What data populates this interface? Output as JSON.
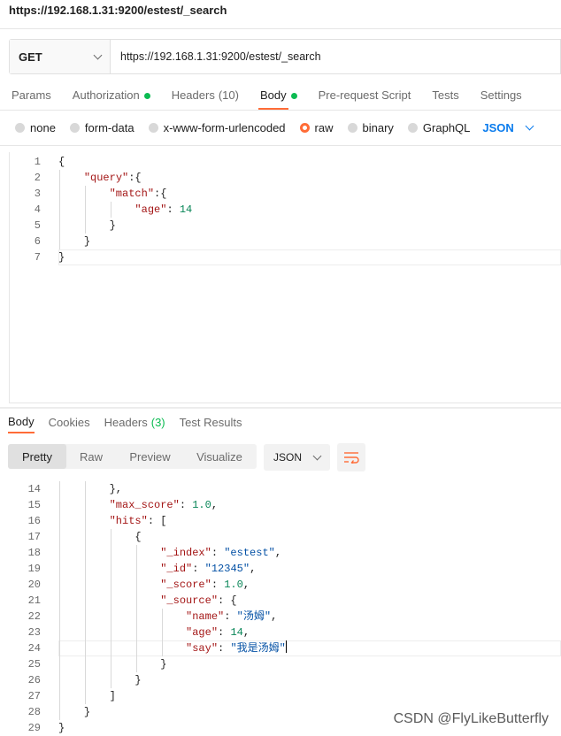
{
  "title": "https://192.168.1.31:9200/estest/_search",
  "request": {
    "method": "GET",
    "url": "https://192.168.1.31:9200/estest/_search"
  },
  "tabs": {
    "params": "Params",
    "authorization": "Authorization",
    "headers": "Headers",
    "headers_count": "(10)",
    "body": "Body",
    "prerequest": "Pre-request Script",
    "tests": "Tests",
    "settings": "Settings"
  },
  "body_options": {
    "none": "none",
    "form_data": "form-data",
    "urlencoded": "x-www-form-urlencoded",
    "raw": "raw",
    "binary": "binary",
    "graphql": "GraphQL",
    "format": "JSON"
  },
  "request_body": {
    "line_numbers": [
      "1",
      "2",
      "3",
      "4",
      "5",
      "6",
      "7"
    ],
    "lines": [
      [
        {
          "t": "pun",
          "v": "{"
        }
      ],
      [
        {
          "t": "ws",
          "v": "    "
        },
        {
          "t": "key",
          "v": "\"query\""
        },
        {
          "t": "pun",
          "v": ":{"
        }
      ],
      [
        {
          "t": "ws",
          "v": "        "
        },
        {
          "t": "key",
          "v": "\"match\""
        },
        {
          "t": "pun",
          "v": ":{"
        }
      ],
      [
        {
          "t": "ws",
          "v": "            "
        },
        {
          "t": "key",
          "v": "\"age\""
        },
        {
          "t": "pun",
          "v": ": "
        },
        {
          "t": "num",
          "v": "14"
        }
      ],
      [
        {
          "t": "ws",
          "v": "        "
        },
        {
          "t": "pun",
          "v": "}"
        }
      ],
      [
        {
          "t": "ws",
          "v": "    "
        },
        {
          "t": "pun",
          "v": "}"
        }
      ],
      [
        {
          "t": "pun",
          "v": "}"
        }
      ]
    ]
  },
  "response_tabs": {
    "body": "Body",
    "cookies": "Cookies",
    "headers": "Headers",
    "headers_count": "(3)",
    "test_results": "Test Results"
  },
  "view_modes": {
    "pretty": "Pretty",
    "raw": "Raw",
    "preview": "Preview",
    "visualize": "Visualize",
    "format": "JSON"
  },
  "response_body": {
    "line_numbers": [
      "14",
      "15",
      "16",
      "17",
      "18",
      "19",
      "20",
      "21",
      "22",
      "23",
      "24",
      "25",
      "26",
      "27",
      "28",
      "29"
    ],
    "lines": [
      [
        {
          "t": "ws",
          "v": "        "
        },
        {
          "t": "pun",
          "v": "},"
        }
      ],
      [
        {
          "t": "ws",
          "v": "        "
        },
        {
          "t": "key",
          "v": "\"max_score\""
        },
        {
          "t": "pun",
          "v": ": "
        },
        {
          "t": "num",
          "v": "1.0"
        },
        {
          "t": "pun",
          "v": ","
        }
      ],
      [
        {
          "t": "ws",
          "v": "        "
        },
        {
          "t": "key",
          "v": "\"hits\""
        },
        {
          "t": "pun",
          "v": ": ["
        }
      ],
      [
        {
          "t": "ws",
          "v": "            "
        },
        {
          "t": "pun",
          "v": "{"
        }
      ],
      [
        {
          "t": "ws",
          "v": "                "
        },
        {
          "t": "key",
          "v": "\"_index\""
        },
        {
          "t": "pun",
          "v": ": "
        },
        {
          "t": "str",
          "v": "\"estest\""
        },
        {
          "t": "pun",
          "v": ","
        }
      ],
      [
        {
          "t": "ws",
          "v": "                "
        },
        {
          "t": "key",
          "v": "\"_id\""
        },
        {
          "t": "pun",
          "v": ": "
        },
        {
          "t": "str",
          "v": "\"12345\""
        },
        {
          "t": "pun",
          "v": ","
        }
      ],
      [
        {
          "t": "ws",
          "v": "                "
        },
        {
          "t": "key",
          "v": "\"_score\""
        },
        {
          "t": "pun",
          "v": ": "
        },
        {
          "t": "num",
          "v": "1.0"
        },
        {
          "t": "pun",
          "v": ","
        }
      ],
      [
        {
          "t": "ws",
          "v": "                "
        },
        {
          "t": "key",
          "v": "\"_source\""
        },
        {
          "t": "pun",
          "v": ": {"
        }
      ],
      [
        {
          "t": "ws",
          "v": "                    "
        },
        {
          "t": "key",
          "v": "\"name\""
        },
        {
          "t": "pun",
          "v": ": "
        },
        {
          "t": "str",
          "v": "\"汤姆\""
        },
        {
          "t": "pun",
          "v": ","
        }
      ],
      [
        {
          "t": "ws",
          "v": "                    "
        },
        {
          "t": "key",
          "v": "\"age\""
        },
        {
          "t": "pun",
          "v": ": "
        },
        {
          "t": "num",
          "v": "14"
        },
        {
          "t": "pun",
          "v": ","
        }
      ],
      [
        {
          "t": "ws",
          "v": "                    "
        },
        {
          "t": "key",
          "v": "\"say\""
        },
        {
          "t": "pun",
          "v": ": "
        },
        {
          "t": "str",
          "v": "\"我是汤姆\""
        },
        {
          "t": "cur",
          "v": ""
        }
      ],
      [
        {
          "t": "ws",
          "v": "                "
        },
        {
          "t": "pun",
          "v": "}"
        }
      ],
      [
        {
          "t": "ws",
          "v": "            "
        },
        {
          "t": "pun",
          "v": "}"
        }
      ],
      [
        {
          "t": "ws",
          "v": "        "
        },
        {
          "t": "pun",
          "v": "]"
        }
      ],
      [
        {
          "t": "ws",
          "v": "    "
        },
        {
          "t": "pun",
          "v": "}"
        }
      ],
      [
        {
          "t": "pun",
          "v": "}"
        }
      ]
    ]
  },
  "watermark": "CSDN @FlyLikeButterfly",
  "colors": {
    "accent": "#ff6c37",
    "success": "#0cbb52",
    "link": "#097bed"
  }
}
